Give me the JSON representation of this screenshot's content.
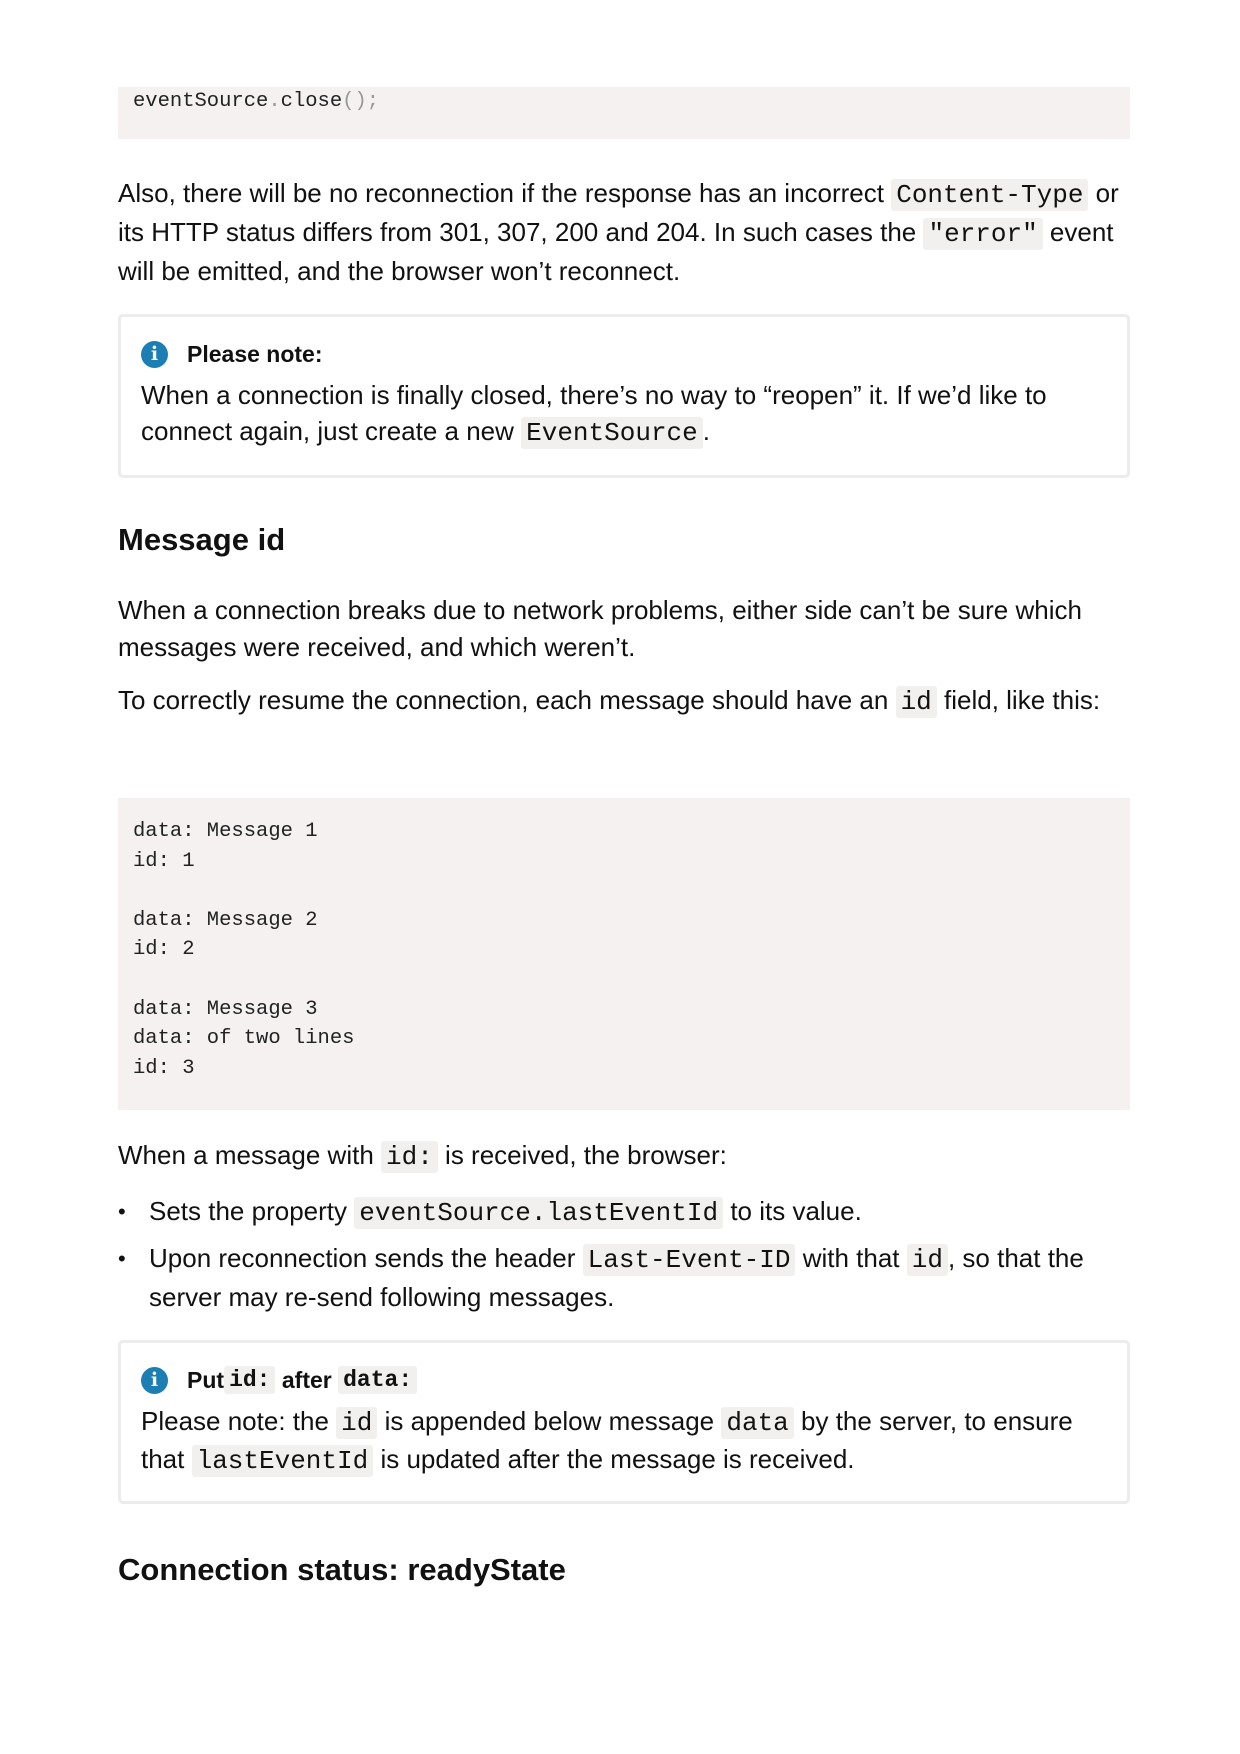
{
  "code_top": {
    "obj": "eventSource",
    "dot": ".",
    "method": "close",
    "parens": "()",
    "semi": ";"
  },
  "para1": {
    "t1": "Also, there will be no reconnection if the response has an incorrect ",
    "c1": "Content-Type",
    "t2": " or its HTTP status differs from 301, 307, 200 and 204. In such cases the ",
    "c2": "\"error\"",
    "t3": " event will be emitted, and the browser won’t reconnect."
  },
  "note1": {
    "icon": "info-icon",
    "title": "Please note:",
    "t1": "When a connection is finally closed, there’s no way to “reopen” it. If we’d like to connect again, just create a new ",
    "c1": "EventSource",
    "t2": "."
  },
  "heading1": "Message id",
  "para2": "When a connection breaks due to network problems, either side can’t be sure which messages were received, and which weren’t.",
  "para3": {
    "t1": "To correctly resume the connection, each message should have an ",
    "c1": "id",
    "t2": " field, like this:"
  },
  "code_main": {
    "lines": [
      "data: Message 1",
      "id: 1",
      "",
      "data: Message 2",
      "id: 2",
      "",
      "data: Message 3",
      "data: of two lines",
      "id: 3"
    ]
  },
  "para4": {
    "t1": "When a message with ",
    "c1": "id:",
    "t2": " is received, the browser:"
  },
  "bullets": [
    {
      "dot": "•",
      "t1": "Sets the property ",
      "c1": "eventSource.lastEventId",
      "t2": " to its value."
    },
    {
      "dot": "•",
      "t1": "Upon reconnection sends the header ",
      "c1": "Last-Event-ID",
      "t2": " with that ",
      "c2": "id",
      "t3": ", so that the server may re-send following messages."
    }
  ],
  "note2": {
    "icon": "info-icon",
    "title_t1": "Put ",
    "title_c1": "id:",
    "title_t2": " after ",
    "title_c2": "data:",
    "t1": "Please note: the ",
    "c1": "id",
    "t2": " is appended below message ",
    "c2": "data",
    "t3": " by the server, to ensure that ",
    "c3": "lastEventId",
    "t4": " is updated after the message is received."
  },
  "heading2": "Connection status: readyState",
  "colors": {
    "code_bg": "#f4f1f0",
    "info_icon": "#1d7eb3",
    "note_border": "#ececec"
  }
}
